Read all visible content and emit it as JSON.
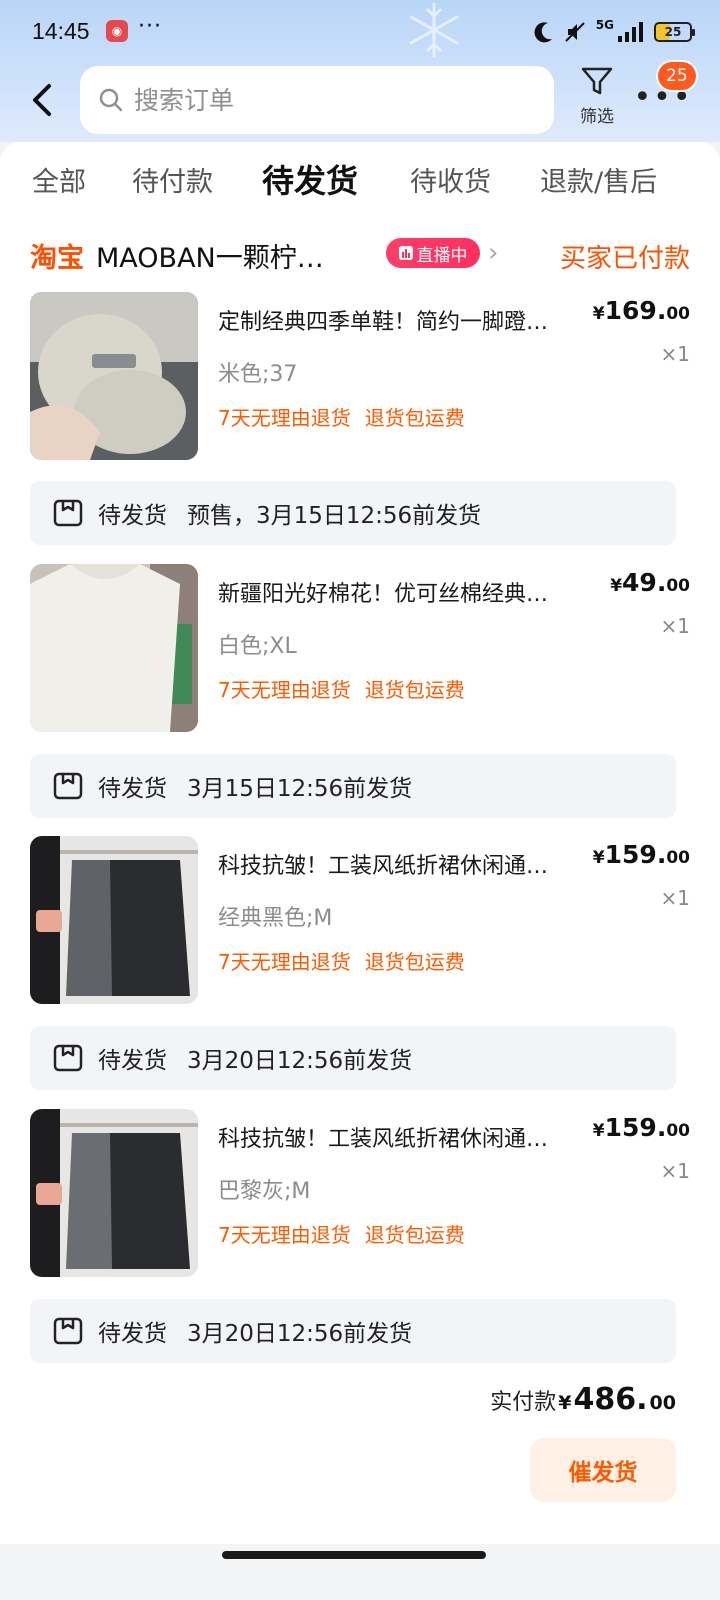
{
  "status_bar": {
    "time": "14:45",
    "more": "···",
    "network": "5G",
    "battery": "25"
  },
  "header": {
    "search_placeholder": "搜索订单",
    "filter_label": "筛选",
    "more_badge": "25"
  },
  "tabs": [
    {
      "label": "全部",
      "active": false
    },
    {
      "label": "待付款",
      "active": false
    },
    {
      "label": "待发货",
      "active": true
    },
    {
      "label": "待收货",
      "active": false
    },
    {
      "label": "退款/售后",
      "active": false
    }
  ],
  "order": {
    "platform": "淘宝",
    "shop_name": "MAOBAN一颗柠…",
    "live_label": "直播中",
    "status": "买家已付款",
    "items": [
      {
        "title": "定制经典四季单鞋！简约一脚蹬…",
        "price_symbol": "¥",
        "price_int": "169.",
        "price_dec": "00",
        "qty": "×1",
        "variant": "米色;37",
        "tags": [
          "7天无理由退货",
          "退货包运费"
        ],
        "ship_status": "待发货",
        "ship_text": "预售，3月15日12:56前发货"
      },
      {
        "title": "新疆阳光好棉花！优可丝棉经典…",
        "price_symbol": "¥",
        "price_int": "49.",
        "price_dec": "00",
        "qty": "×1",
        "variant": "白色;XL",
        "tags": [
          "7天无理由退货",
          "退货包运费"
        ],
        "ship_status": "待发货",
        "ship_text": "3月15日12:56前发货"
      },
      {
        "title": "科技抗皱！工装风纸折裙休闲通…",
        "price_symbol": "¥",
        "price_int": "159.",
        "price_dec": "00",
        "qty": "×1",
        "variant": "经典黑色;M",
        "tags": [
          "7天无理由退货",
          "退货包运费"
        ],
        "ship_status": "待发货",
        "ship_text": "3月20日12:56前发货"
      },
      {
        "title": "科技抗皱！工装风纸折裙休闲通…",
        "price_symbol": "¥",
        "price_int": "159.",
        "price_dec": "00",
        "qty": "×1",
        "variant": "巴黎灰;M",
        "tags": [
          "7天无理由退货",
          "退货包运费"
        ],
        "ship_status": "待发货",
        "ship_text": "3月20日12:56前发货"
      }
    ],
    "total_label": "实付款",
    "total_symbol": "¥",
    "total_int": "486.",
    "total_dec": "00",
    "urge_button": "催发货"
  },
  "colors": {
    "accent": "#ff5a00",
    "taobao": "#ff5000",
    "live": "#ff2f5e"
  }
}
